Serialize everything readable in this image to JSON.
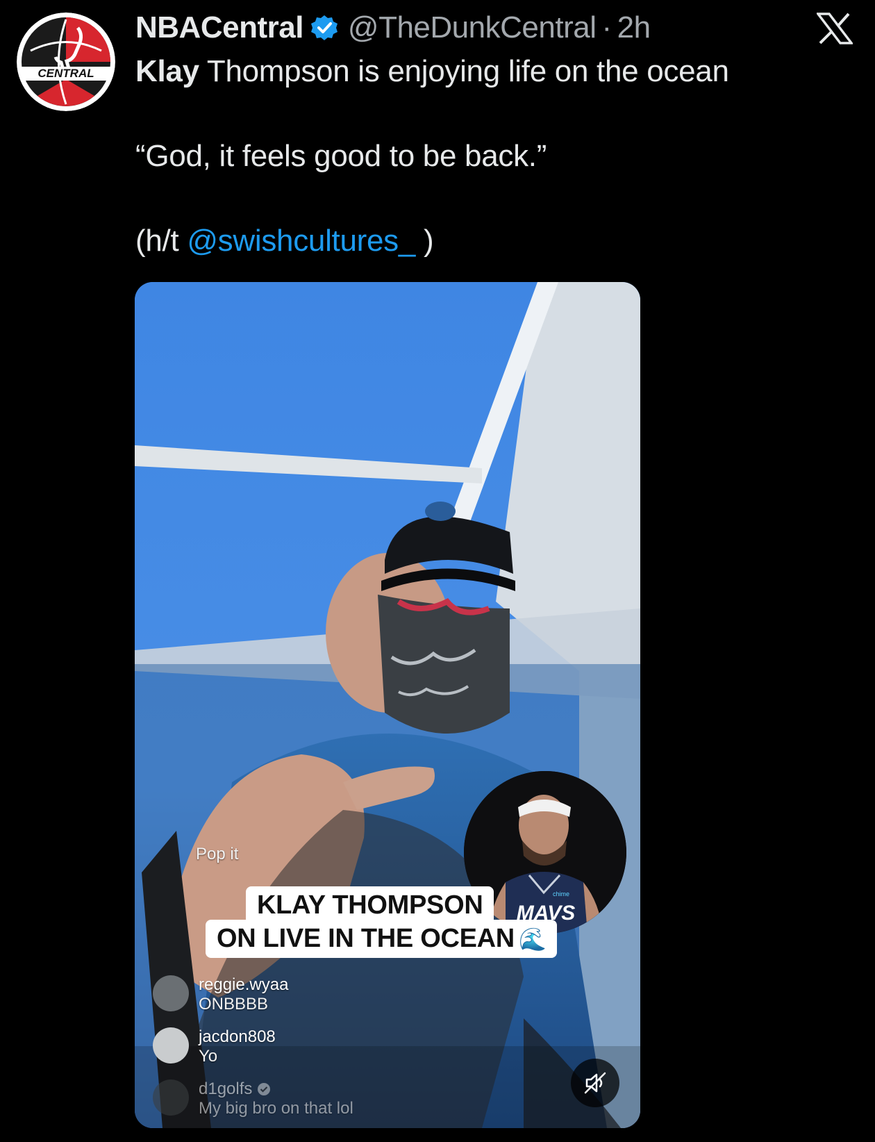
{
  "author": {
    "display_name": "NBACentral",
    "handle": "@TheDunkCentral",
    "separator": "·",
    "time": "2h",
    "avatar_icon": "nba-central-logo",
    "avatar_text": "CENTRAL",
    "verified_icon": "verified-badge-icon"
  },
  "close": {
    "icon": "x-logo-icon"
  },
  "tweet": {
    "line1_bold": "Klay",
    "line1_rest": " Thompson is enjoying life on the ocean",
    "quote": "“God, it feels good to be back.”",
    "credit_prefix": "(h/t ",
    "credit_mention": "@swishcultures_",
    "credit_suffix": " )"
  },
  "media": {
    "caption_line1": "KLAY THOMPSON",
    "caption_line2": "ON LIVE IN THE OCEAN",
    "caption_emoji": "🌊",
    "overlay_comment_partial": "Pop it",
    "inset_jersey_text": "MAVS",
    "inset_sponsor": "chime",
    "comments": [
      {
        "user": "reggie.wyaa",
        "text": "ONBBBB"
      },
      {
        "user": "jacdon808",
        "text": "Yo"
      },
      {
        "user": "d1golfs",
        "text": "My big bro on that lol"
      }
    ],
    "mute_icon": "speaker-muted-icon"
  },
  "colors": {
    "background": "#000000",
    "text": "#e7e9ea",
    "secondary": "#a3a8ad",
    "link": "#1d9bf0",
    "verified": "#1d9bf0"
  }
}
